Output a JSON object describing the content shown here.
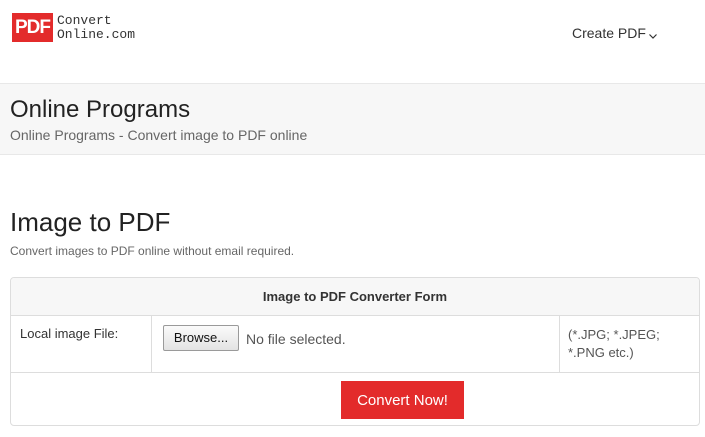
{
  "header": {
    "logo_badge": "PDF",
    "logo_line1": "Convert",
    "logo_line2": "Online.com",
    "nav_create": "Create PDF"
  },
  "band": {
    "title": "Online Programs",
    "breadcrumb": "Online Programs - Convert image to PDF online"
  },
  "main": {
    "title": "Image to PDF",
    "description": "Convert images to PDF online without email required."
  },
  "form": {
    "heading": "Image to PDF Converter Form",
    "file_label": "Local image File:",
    "browse_label": "Browse...",
    "no_file_text": "No file selected.",
    "formats_line1": "(*.JPG; *.JPEG;",
    "formats_line2": "*.PNG etc.)",
    "submit_label": "Convert Now!"
  },
  "colors": {
    "brand_red": "#e32b2b",
    "band_bg": "#f7f7f7",
    "border": "#dddddd"
  },
  "icons": {
    "nav_dropdown": "chevron-down-icon"
  }
}
